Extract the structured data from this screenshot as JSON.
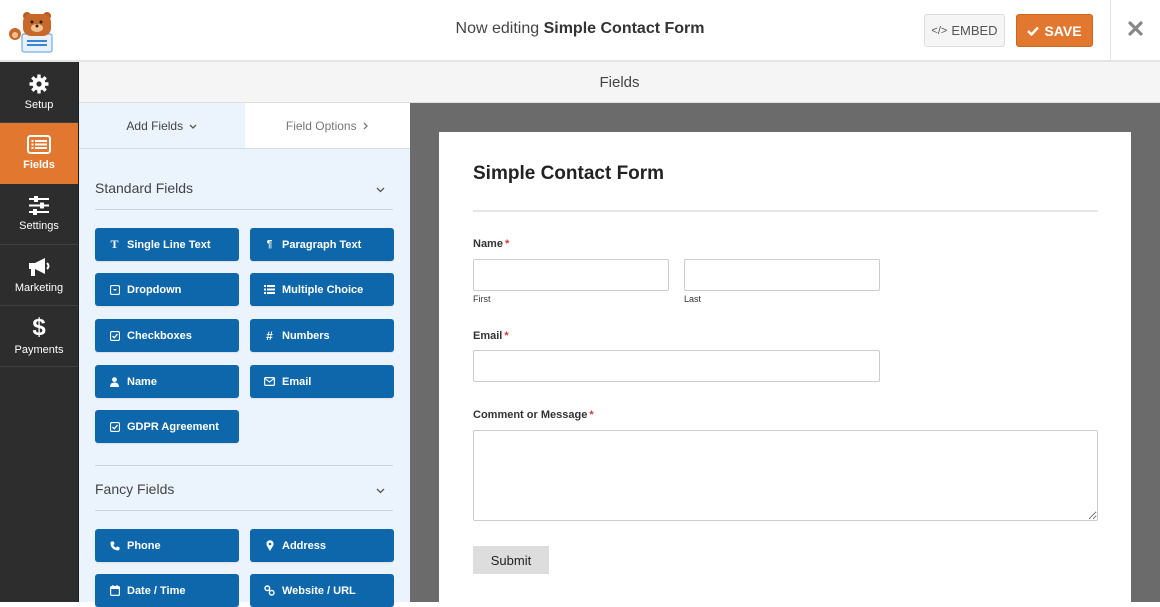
{
  "topbar": {
    "prefix": "Now editing",
    "form_name": "Simple Contact Form",
    "embed_label": "EMBED",
    "save_label": "SAVE",
    "save_color": "#e27730"
  },
  "leftnav": {
    "items": [
      {
        "label": "Setup",
        "icon": "gear-icon"
      },
      {
        "label": "Fields",
        "icon": "fields-list-icon",
        "active": true
      },
      {
        "label": "Settings",
        "icon": "sliders-icon"
      },
      {
        "label": "Marketing",
        "icon": "megaphone-icon"
      },
      {
        "label": "Payments",
        "icon": "dollar-icon"
      }
    ]
  },
  "fields_header": "Fields",
  "panel": {
    "tabs": [
      {
        "label": "Add Fields",
        "active": true
      },
      {
        "label": "Field Options",
        "active": false
      }
    ],
    "sections": [
      {
        "title": "Standard Fields",
        "buttons": [
          {
            "label": "Single Line Text",
            "icon": "text-cursor-icon"
          },
          {
            "label": "Paragraph Text",
            "icon": "paragraph-icon"
          },
          {
            "label": "Dropdown",
            "icon": "dropdown-icon"
          },
          {
            "label": "Multiple Choice",
            "icon": "list-icon"
          },
          {
            "label": "Checkboxes",
            "icon": "checkbox-icon"
          },
          {
            "label": "Numbers",
            "icon": "hash-icon"
          },
          {
            "label": "Name",
            "icon": "user-icon"
          },
          {
            "label": "Email",
            "icon": "envelope-icon"
          },
          {
            "label": "GDPR Agreement",
            "icon": "checkbox-icon"
          }
        ]
      },
      {
        "title": "Fancy Fields",
        "buttons": [
          {
            "label": "Phone",
            "icon": "phone-icon"
          },
          {
            "label": "Address",
            "icon": "map-marker-icon"
          },
          {
            "label": "Date / Time",
            "icon": "calendar-icon"
          },
          {
            "label": "Website / URL",
            "icon": "link-icon"
          }
        ]
      }
    ]
  },
  "form": {
    "title": "Simple Contact Form",
    "name_label": "Name",
    "first_sublabel": "First",
    "last_sublabel": "Last",
    "email_label": "Email",
    "message_label": "Comment or Message",
    "required_mark": "*",
    "first_value": "",
    "last_value": "",
    "email_value": "",
    "message_value": "",
    "submit_label": "Submit"
  }
}
